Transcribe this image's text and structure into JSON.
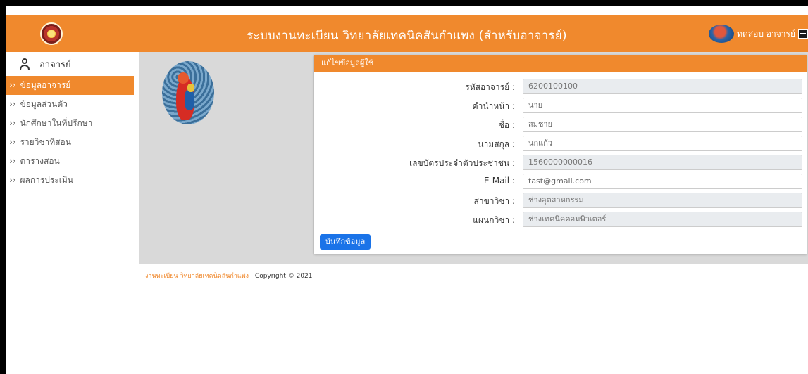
{
  "header": {
    "title": "ระบบงานทะเบียน วิทยาลัยเทคนิคสันกำแพง (สำหรับอาจารย์)",
    "user_name": "ทดสอบ อาจารย์"
  },
  "sidebar": {
    "heading": "อาจารย์",
    "items": [
      {
        "label": "ข้อมูลอาจารย์",
        "active": true
      },
      {
        "label": "ข้อมูลส่วนตัว",
        "active": false
      },
      {
        "label": "นักศึกษาในที่ปรึกษา",
        "active": false
      },
      {
        "label": "รายวิชาที่สอน",
        "active": false
      },
      {
        "label": "ตารางสอน",
        "active": false
      },
      {
        "label": "ผลการประเมิน",
        "active": false
      }
    ],
    "item_marker": "››"
  },
  "form": {
    "title": "แก้ไขข้อมูลผู้ใช้",
    "fields": [
      {
        "label": "รหัสอาจารย์ :",
        "value": "6200100100",
        "readonly": true
      },
      {
        "label": "คำนำหน้า :",
        "value": "นาย",
        "readonly": false
      },
      {
        "label": "ชื่อ :",
        "value": "สมชาย",
        "readonly": false
      },
      {
        "label": "นามสกุล :",
        "value": "นกแก้ว",
        "readonly": false
      },
      {
        "label": "เลขบัตรประจำตัวประชาชน :",
        "value": "1560000000016",
        "readonly": true
      },
      {
        "label": "E-Mail :",
        "value": "tast@gmail.com",
        "readonly": false
      },
      {
        "label": "สาขาวิชา :",
        "value": "ช่างอุตสาหกรรม",
        "readonly": true
      },
      {
        "label": "แผนกวิชา :",
        "value": "ช่างเทคนิคคอมพิวเตอร์",
        "readonly": true
      }
    ],
    "save_label": "บันทึกข้อมูล"
  },
  "footer": {
    "org": "งานทะเบียน วิทยาลัยเทคนิคสันกำแพง",
    "copyright": "Copyright © 2021"
  },
  "colors": {
    "accent": "#F0892D",
    "button": "#1a73e8",
    "content_bg": "#d9d9d9"
  }
}
